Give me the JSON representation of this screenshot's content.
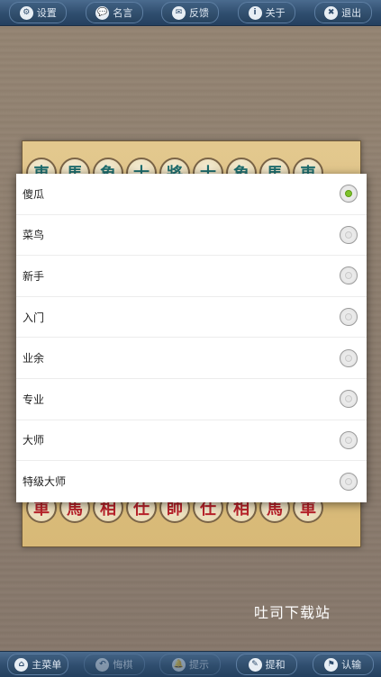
{
  "top_toolbar": [
    {
      "label": "设置",
      "icon": "gear-icon",
      "glyph": "⚙"
    },
    {
      "label": "名言",
      "icon": "speech-bubble-icon",
      "glyph": "💬"
    },
    {
      "label": "反馈",
      "icon": "mail-icon",
      "glyph": "✉"
    },
    {
      "label": "关于",
      "icon": "info-icon",
      "glyph": "i"
    },
    {
      "label": "退出",
      "icon": "close-icon",
      "glyph": "✖"
    }
  ],
  "board": {
    "black_row": [
      "車",
      "馬",
      "象",
      "士",
      "將",
      "士",
      "象",
      "馬",
      "車"
    ],
    "red_row": [
      "車",
      "馬",
      "相",
      "仕",
      "帥",
      "仕",
      "相",
      "馬",
      "車"
    ]
  },
  "difficulty_dialog": {
    "options": [
      {
        "label": "傻瓜",
        "selected": true
      },
      {
        "label": "菜鸟",
        "selected": false
      },
      {
        "label": "新手",
        "selected": false
      },
      {
        "label": "入门",
        "selected": false
      },
      {
        "label": "业余",
        "selected": false
      },
      {
        "label": "专业",
        "selected": false
      },
      {
        "label": "大师",
        "selected": false
      },
      {
        "label": "特级大师",
        "selected": false
      }
    ]
  },
  "bottom_toolbar": [
    {
      "label": "主菜单",
      "icon": "home-icon",
      "glyph": "⌂",
      "enabled": true
    },
    {
      "label": "悔棋",
      "icon": "undo-icon",
      "glyph": "↶",
      "enabled": false
    },
    {
      "label": "提示",
      "icon": "bell-icon",
      "glyph": "🔔",
      "enabled": false
    },
    {
      "label": "提和",
      "icon": "pencil-icon",
      "glyph": "✎",
      "enabled": true
    },
    {
      "label": "认输",
      "icon": "flag-icon",
      "glyph": "⚑",
      "enabled": true
    }
  ],
  "watermark": "吐司下载站",
  "colors": {
    "toolbar": "#2f4d6e",
    "radio_selected": "#7ec32a",
    "black_piece": "#1f6e6e",
    "red_piece": "#b8222a"
  }
}
